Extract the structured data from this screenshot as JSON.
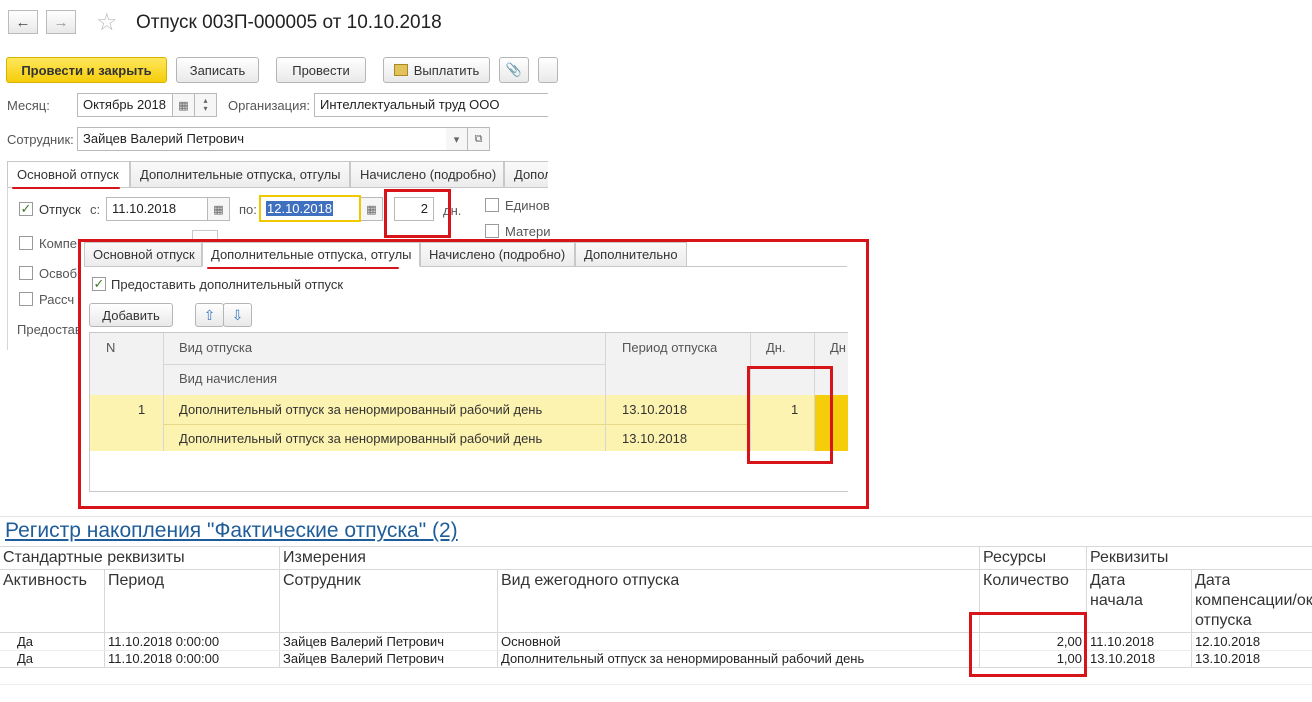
{
  "window": {
    "title": "Отпуск 003П-000005 от 10.10.2018",
    "back_icon": "arrow-left-icon",
    "forward_icon": "arrow-right-icon",
    "favorite_icon": "star-icon"
  },
  "toolbar": {
    "post_close": "Провести и закрыть",
    "save": "Записать",
    "post": "Провести",
    "pay": "Выплатить"
  },
  "form": {
    "month_label": "Месяц:",
    "month_value": "Октябрь 2018",
    "org_label": "Организация:",
    "org_value": "Интеллектуальный труд ООО",
    "employee_label": "Сотрудник:",
    "employee_value": "Зайцев Валерий Петрович"
  },
  "tabs": [
    {
      "label": "Основной отпуск"
    },
    {
      "label": "Дополнительные отпуска, отгулы"
    },
    {
      "label": "Начислено (подробно)"
    },
    {
      "label": "Допол"
    }
  ],
  "main_tab": {
    "vacation_label": "Отпуск",
    "vacation_checked": true,
    "from_label": "с:",
    "from_value": "11.10.2018",
    "to_label": "по:",
    "to_value": "12.10.2018",
    "days_value": "2",
    "days_unit": "дн.",
    "single_label": "Единов",
    "mater_label": "Матери",
    "comp_label": "Компе",
    "osvob_label": "Освоб",
    "rass_label": "Рассч",
    "predost_label": "Предостав"
  },
  "popup": {
    "tabs": [
      {
        "label": "Основной отпуск"
      },
      {
        "label": "Дополнительные отпуска, отгулы"
      },
      {
        "label": "Начислено (подробно)"
      },
      {
        "label": "Дополнительно"
      }
    ],
    "provide_label": "Предоставить дополнительный отпуск",
    "provide_checked": true,
    "add_button": "Добавить",
    "up_icon": "arrow-up-icon",
    "down_icon": "arrow-down-icon",
    "table": {
      "col_n": "N",
      "col_kind": "Вид отпуска",
      "col_accrual": "Вид начисления",
      "col_period": "Период отпуска",
      "col_days": "Дн.",
      "col_days2": "Дн",
      "rows": [
        {
          "n": "1",
          "kind": "Дополнительный отпуск за ненормированный рабочий день",
          "accrual": "Дополнительный отпуск за ненормированный рабочий день",
          "period1": "13.10.2018",
          "period2": "13.10.2018",
          "days": "1"
        }
      ]
    }
  },
  "register": {
    "title": "Регистр накопления \"Фактические отпуска\" (2)",
    "groups": {
      "standard": "Стандартные реквизиты",
      "dimensions": "Измерения",
      "resources": "Ресурсы",
      "attributes": "Реквизиты"
    },
    "columns": {
      "activity": "Активность",
      "period": "Период",
      "employee": "Сотрудник",
      "kind": "Вид ежегодного отпуска",
      "qty": "Количество",
      "start_line1": "Дата",
      "start_line2": "начала",
      "comp_line1": "Дата",
      "comp_line2": "компенсации/ок",
      "comp_line3": "отпуска"
    },
    "rows": [
      {
        "active": "Да",
        "period": "11.10.2018 0:00:00",
        "employee": "Зайцев Валерий Петрович",
        "kind": "Основной",
        "qty": "2,00",
        "start": "11.10.2018",
        "comp": "12.10.2018"
      },
      {
        "active": "Да",
        "period": "11.10.2018 0:00:00",
        "employee": "Зайцев Валерий Петрович",
        "kind": "Дополнительный отпуск за ненормированный рабочий день",
        "qty": "1,00",
        "start": "13.10.2018",
        "comp": "13.10.2018"
      }
    ]
  },
  "colors": {
    "accent_red": "#d7141a",
    "primary_yellow": "#f5cd0b",
    "row_highlight": "#fdf3b0",
    "link_blue": "#1f5d9a"
  }
}
